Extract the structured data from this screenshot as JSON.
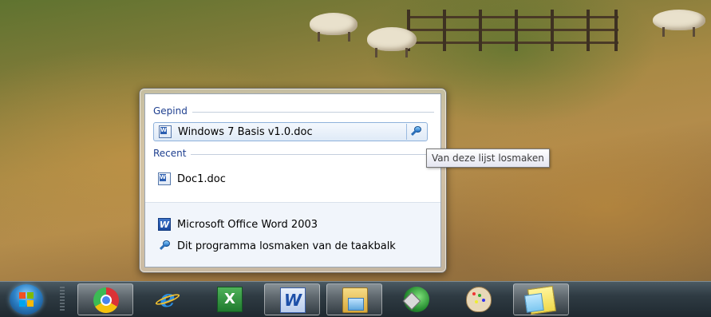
{
  "jumplist": {
    "pinned_header": "Gepind",
    "pinned_items": [
      {
        "label": "Windows 7 Basis v1.0.doc",
        "icon": "word-document-icon",
        "action_icon": "pin-icon"
      }
    ],
    "recent_header": "Recent",
    "recent_items": [
      {
        "label": "Doc1.doc",
        "icon": "word-document-icon"
      }
    ],
    "tasks": [
      {
        "label": "Microsoft Office Word 2003",
        "icon": "word-app-icon"
      },
      {
        "label": "Dit programma losmaken van de taakbalk",
        "icon": "unpin-icon"
      }
    ]
  },
  "tooltip": {
    "text": "Van deze lijst losmaken"
  },
  "taskbar": {
    "start_button": "windows-start-orb-icon",
    "buttons": [
      {
        "app": "Google Chrome",
        "icon": "chrome-icon",
        "active": true
      },
      {
        "app": "Internet Explorer",
        "icon": "internet-explorer-icon",
        "active": false
      },
      {
        "app": "Microsoft Excel",
        "icon": "excel-icon",
        "active": false
      },
      {
        "app": "Microsoft Word",
        "icon": "word-icon",
        "active": true
      },
      {
        "app": "Windows Explorer",
        "icon": "explorer-icon",
        "active": true
      },
      {
        "app": "Windows Media Center",
        "icon": "media-center-icon",
        "active": false
      },
      {
        "app": "Paint",
        "icon": "paint-icon",
        "active": false
      },
      {
        "app": "Sticky Notes",
        "icon": "sticky-notes-icon",
        "active": true
      }
    ]
  }
}
